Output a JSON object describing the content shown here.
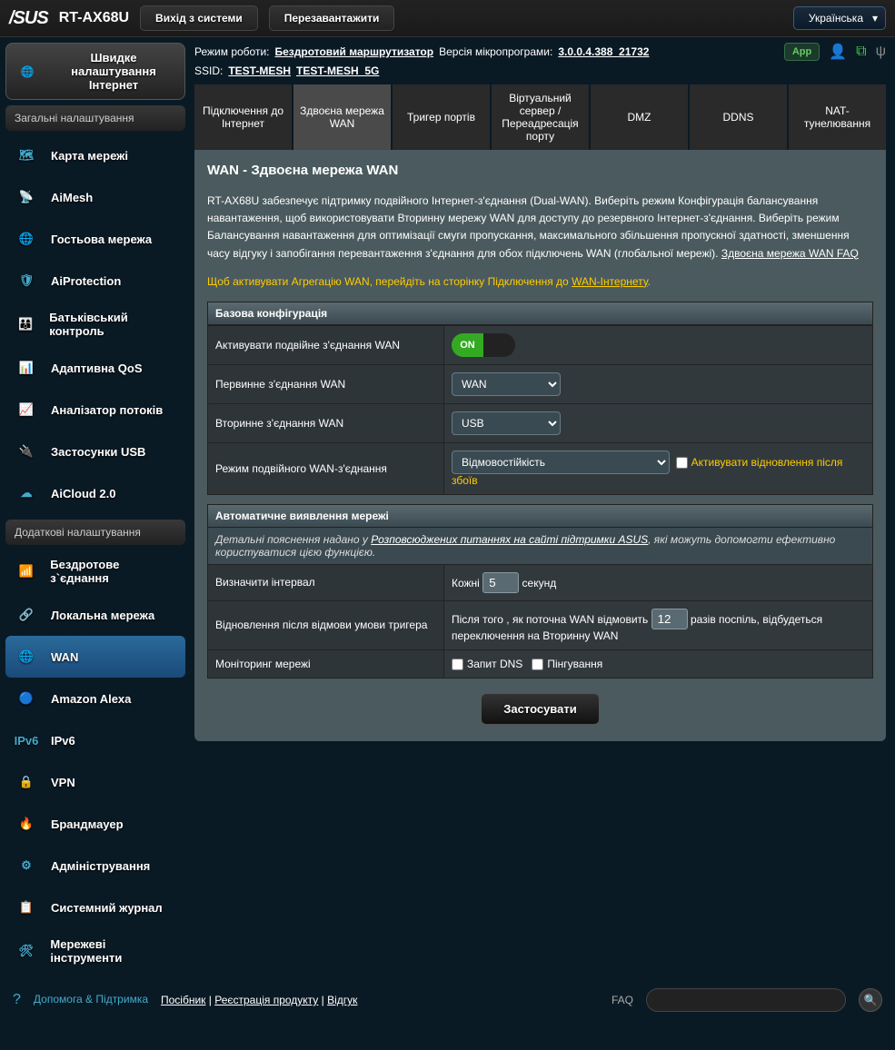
{
  "header": {
    "brand": "/SUS",
    "model": "RT-AX68U",
    "logout": "Вихід з системи",
    "reboot": "Перезавантажити",
    "language": "Українська"
  },
  "info": {
    "mode_label": "Режим роботи:",
    "mode_value": "Бездротовий маршрутизатор",
    "fw_label": "Версія мікропрограми:",
    "fw_value": "3.0.0.4.388_21732",
    "ssid_label": "SSID:",
    "ssid1": "TEST-MESH",
    "ssid2": "TEST-MESH_5G",
    "app": "App"
  },
  "qis": "Швидке налаштування Інтернет",
  "sec_general": "Загальні налаштування",
  "sec_adv": "Додаткові налаштування",
  "nav_general": [
    "Карта мережі",
    "AiMesh",
    "Гостьова мережа",
    "AiProtection",
    "Батьківський контроль",
    "Адаптивна QoS",
    "Аналізатор потоків",
    "Застосунки USB",
    "AiCloud 2.0"
  ],
  "nav_adv": [
    "Бездротове з`єднання",
    "Локальна мережа",
    "WAN",
    "Amazon Alexa",
    "IPv6",
    "VPN",
    "Брандмауер",
    "Адміністрування",
    "Системний журнал",
    "Мережеві інструменти"
  ],
  "tabs": [
    "Підключення до Інтернет",
    "Здвоєна мережа WAN",
    "Тригер портів",
    "Віртуальний сервер / Переадресація порту",
    "DMZ",
    "DDNS",
    "NAT-тунелювання"
  ],
  "page": {
    "title": "WAN - Здвоєна мережа WAN",
    "desc": "RT-AX68U забезпечує підтримку подвійного Інтернет-з'єднання (Dual-WAN). Виберіть режим Конфігурація балансування навантаження, щоб використовувати Вторинну мережу WAN для доступу до резервного Інтернет-з'єднання. Виберіть режим Балансування навантаження для оптимізації смуги пропускання, максимального збільшення пропускної здатності, зменшення часу відгуку і запобігання перевантаження з'єднання для обох підключень WAN (глобальної мережі).",
    "faq_link": "Здвоєна мережа WAN FAQ",
    "notice_pre": "Щоб активувати Агрегацію WAN, перейдіть на сторінку Підключення до ",
    "notice_link": "WAN-Інтернету",
    "sec_basic": "Базова конфігурація",
    "enable_lbl": "Активувати подвійне з'єднання WAN",
    "on": "ON",
    "primary_lbl": "Первинне з'єднання WAN",
    "primary_val": "WAN",
    "secondary_lbl": "Вторинне з'єднання WAN",
    "secondary_val": "USB",
    "mode_lbl": "Режим подвійного WAN-з'єднання",
    "mode_val": "Відмовостійкість",
    "fallback_lbl": "Активувати відновлення після збоїв",
    "sec_detect": "Автоматичне виявлення мережі",
    "detect_sub_pre": "Детальні пояснення надано у  ",
    "detect_sub_link": "Розповсюджених питаннях на сайті підтримки ASUS",
    "detect_sub_post": ", які можуть допомогти ефективно користуватися цією функцією.",
    "interval_lbl": "Визначити інтервал",
    "interval_pre": "Кожні",
    "interval_val": "5",
    "interval_post": "секунд",
    "failover_lbl": "Відновлення після відмови умови тригера",
    "failover_pre": "Після того , як поточна WAN відмовить",
    "failover_val": "12",
    "failover_post": "разів поспіль, відбудеться переключення на Вторинну WAN",
    "monitor_lbl": "Моніторинг мережі",
    "monitor_dns": "Запит DNS",
    "monitor_ping": "Пінгування",
    "apply": "Застосувати"
  },
  "footer": {
    "help": "Допомога & Підтримка",
    "manual": "Посібник",
    "reg": "Реєстрація продукту",
    "feedback": "Відгук",
    "faq": "FAQ"
  }
}
